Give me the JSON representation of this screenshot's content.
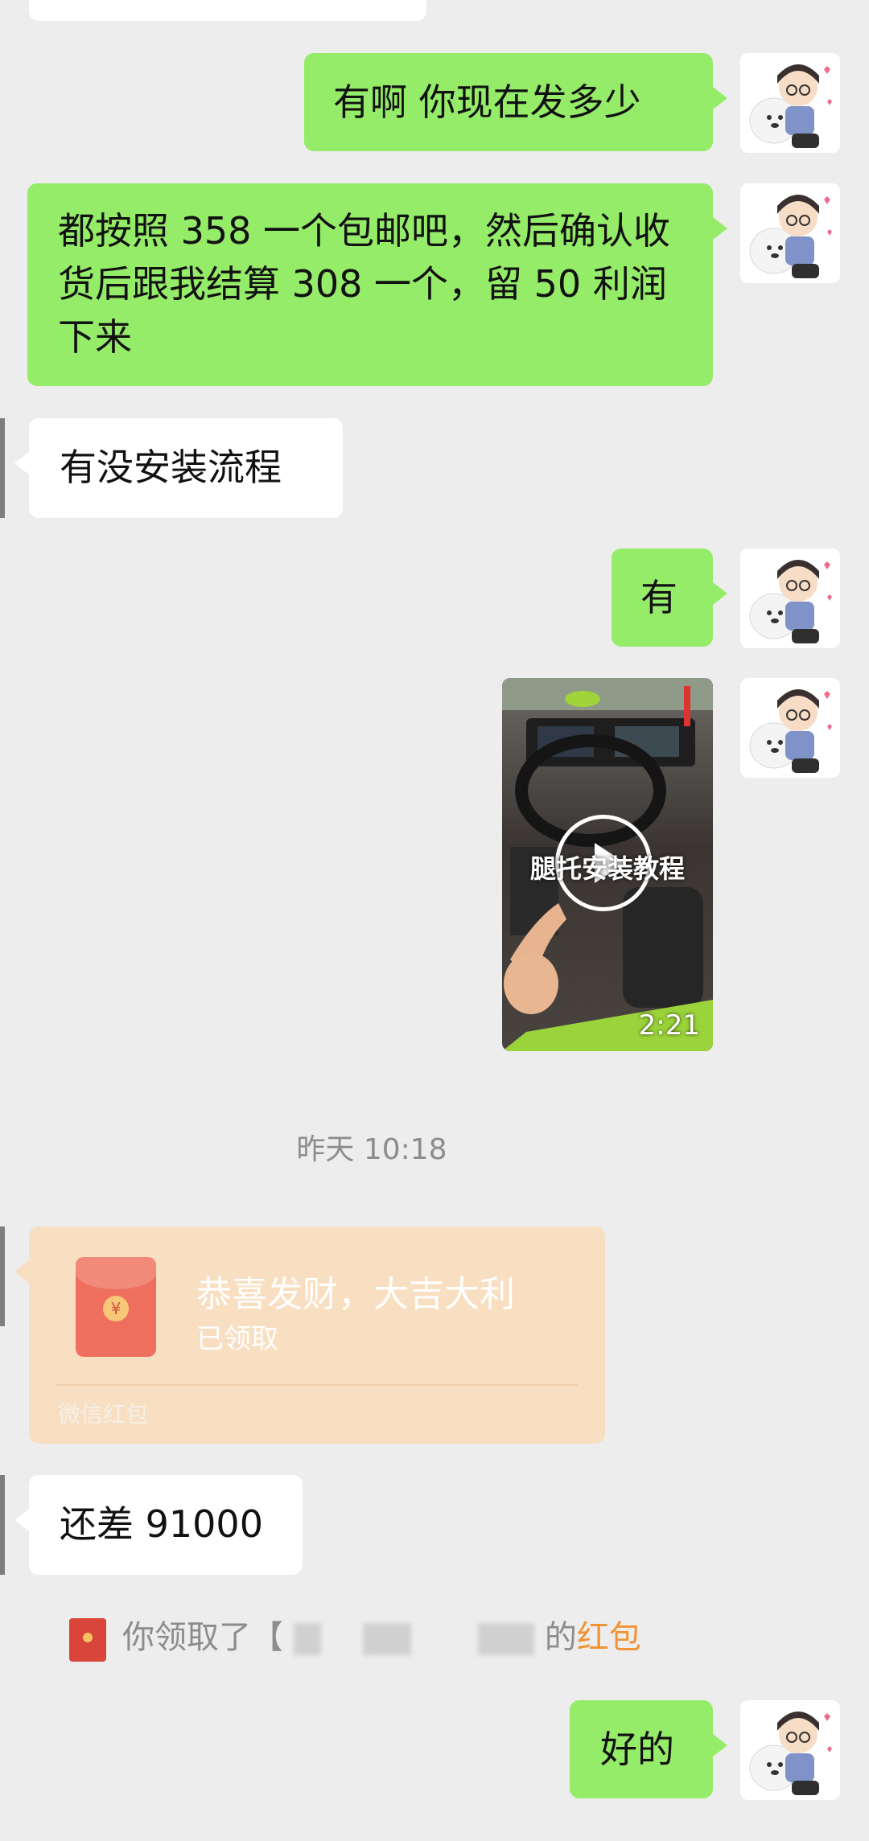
{
  "messages": {
    "m1": "有啊 你现在发多少",
    "m2": "都按照 358 一个包邮吧，然后确认收货后跟我结算 308 一个，留 50 利润下来",
    "m3": "有没安装流程",
    "m4": "有",
    "m5": "还差 91000",
    "m6": "好的"
  },
  "video": {
    "caption": "腿托安装教程",
    "duration": "2:21"
  },
  "timestamp": "昨天 10:18",
  "red_packet": {
    "title": "恭喜发财，大吉大利",
    "status": "已领取",
    "footer": "微信红包",
    "coin_symbol": "¥"
  },
  "system_notice": {
    "prefix": "你领取了【",
    "suffix": "的",
    "link": "红包"
  },
  "avatar": {
    "icon": "boy-with-samoyed-avatar"
  },
  "colors": {
    "outgoing_bubble": "#95ec69",
    "incoming_bubble": "#ffffff",
    "background": "#ededed",
    "red_packet_bg": "#f9dfc1",
    "link": "#f09435"
  }
}
